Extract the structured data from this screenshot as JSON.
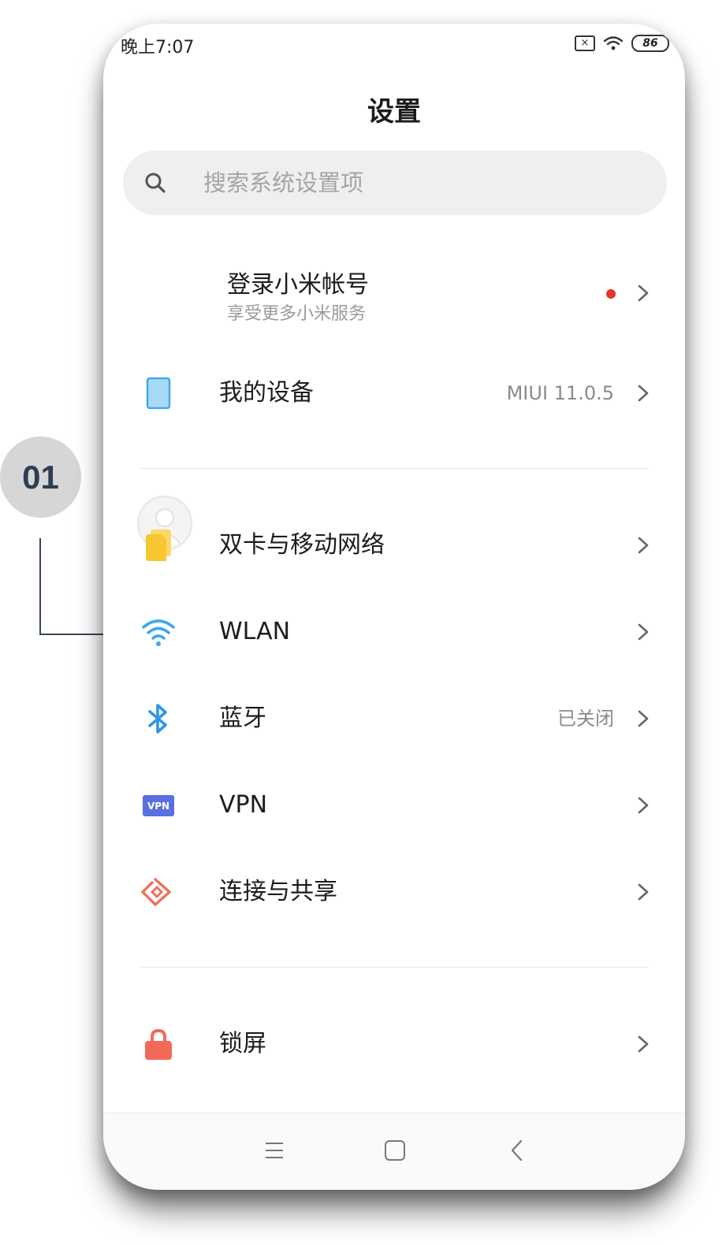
{
  "status_bar": {
    "time": "晚上7:07",
    "battery": "86",
    "icons": [
      "sim-no-signal-icon",
      "wifi-icon",
      "battery-icon"
    ]
  },
  "page_title": "设置",
  "search": {
    "placeholder": "搜索系统设置项",
    "icon": "search-icon"
  },
  "account": {
    "title": "登录小米帐号",
    "subtitle": "享受更多小米服务",
    "has_notification_dot": true
  },
  "my_device": {
    "label": "我的设备",
    "value": "MIUI 11.0.5",
    "icon": "phone-device-icon"
  },
  "network_items": [
    {
      "label": "双卡与移动网络",
      "value": "",
      "icon": "sim-card-icon",
      "color": "#F8C630"
    },
    {
      "label": "WLAN",
      "value": "",
      "icon": "wifi-icon",
      "color": "#3EA7F0"
    },
    {
      "label": "蓝牙",
      "value": "已关闭",
      "icon": "bluetooth-icon",
      "color": "#2E96E8"
    },
    {
      "label": "VPN",
      "value": "",
      "icon": "vpn-icon",
      "color": "#5A6FE0"
    },
    {
      "label": "连接与共享",
      "value": "",
      "icon": "share-icon",
      "color": "#F0705A"
    }
  ],
  "vpn_icon_text": "VPN",
  "lock_screen": {
    "label": "锁屏",
    "icon": "lock-icon",
    "color": "#F16A58"
  },
  "nav_bar": [
    "menu-icon",
    "home-icon",
    "back-icon"
  ],
  "annotation": {
    "number": "01"
  },
  "colors": {
    "notification_dot": "#E53423",
    "callout": "#36465C",
    "badge_bg": "#D6D6D6"
  }
}
